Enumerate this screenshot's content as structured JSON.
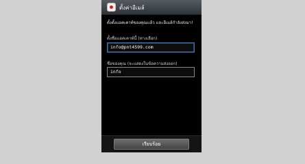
{
  "title_bar": {
    "app_icon": "email-app-icon",
    "title": "ตั้งค่าอีเมล์"
  },
  "intro_text": "ตั้งตั้งแอคเคาท์ของคุณแล้ว และอีเมล์กำลังส่งมา!",
  "account_name": {
    "label": "ตั้งชื่อแอคเคาท์นี้ (ทางเลือก)",
    "value": "info@pnt4599.com"
  },
  "your_name": {
    "label": "ชื่อของคุณ (จะแสดงในข้อความส่งออก)",
    "value": "info"
  },
  "bottom_bar": {
    "done_label": "เรียบร้อย"
  }
}
